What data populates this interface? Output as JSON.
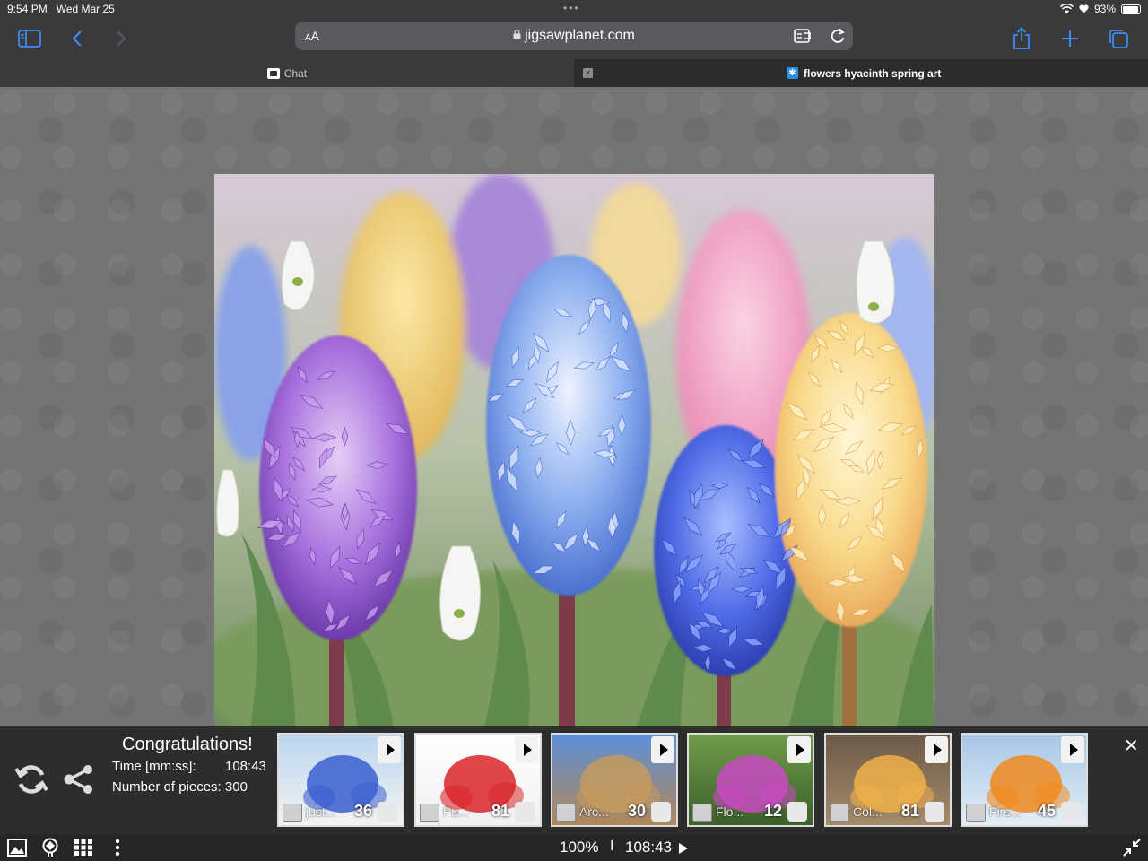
{
  "status": {
    "time": "9:54 PM",
    "date": "Wed Mar 25",
    "battery": "93%",
    "battery_level": 0.93
  },
  "browser": {
    "url": "jigsawplanet.com",
    "aa_small": "A",
    "aa_large": "A",
    "tabs": [
      {
        "label": "Chat",
        "active": false
      },
      {
        "label": "flowers hyacinth spring art",
        "active": true
      }
    ],
    "tab_close_glyph": "×"
  },
  "panel": {
    "congrats": "Congratulations!",
    "time_label": "Time [mm:ss]:",
    "time_value": "108:43",
    "pieces_label": "Number of pieces: 300",
    "close_glyph": "✕",
    "thumbs": [
      {
        "name": "just...",
        "count": "36",
        "bg_top": "#bcd6ef",
        "bg_bottom": "#f3f3f3",
        "accent": "#3a5fd0"
      },
      {
        "name": "Pu...",
        "count": "81",
        "bg_top": "#ffffff",
        "bg_bottom": "#f0f0f0",
        "accent": "#d8262a"
      },
      {
        "name": "Arc...",
        "count": "30",
        "bg_top": "#5d8fd8",
        "bg_bottom": "#b0885a",
        "accent": "#c49a5e"
      },
      {
        "name": "Flo...",
        "count": "12",
        "bg_top": "#6f9c4b",
        "bg_bottom": "#3d5f2a",
        "accent": "#c84ac2"
      },
      {
        "name": "Col...",
        "count": "81",
        "bg_top": "#6c5a48",
        "bg_bottom": "#a58b6a",
        "accent": "#f0b04a"
      },
      {
        "name": "Firs...",
        "count": "45",
        "bg_top": "#a8c6e6",
        "bg_bottom": "#e4eef8",
        "accent": "#f08a1e"
      }
    ]
  },
  "bottombar": {
    "zoom": "100%",
    "separator": "I",
    "timer": "108:43"
  }
}
